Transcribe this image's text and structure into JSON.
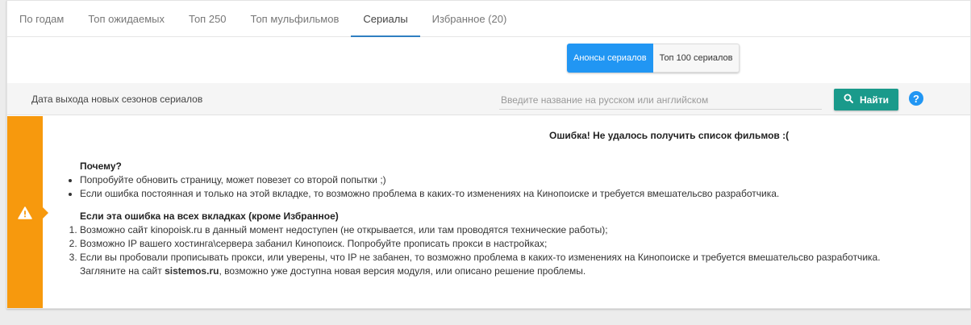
{
  "tabs": [
    {
      "label": "По годам"
    },
    {
      "label": "Топ ожидаемых"
    },
    {
      "label": "Топ 250"
    },
    {
      "label": "Топ мульфильмов"
    },
    {
      "label": "Сериалы"
    },
    {
      "label": "Избранное (20)"
    }
  ],
  "active_tab": "Сериалы",
  "series_toggle": {
    "announces": "Анонсы сериалов",
    "top100": "Топ 100 сериалов",
    "selected": "Анонсы сериалов"
  },
  "search": {
    "section_label": "Дата выхода новых сезонов сериалов",
    "placeholder": "Введите название на русском или английском",
    "value": "",
    "button_label": "Найти"
  },
  "alert": {
    "title": "Ошибка! Не удалось получить список фильмов :(",
    "why_heading": "Почему?",
    "why_items": [
      "Попробуйте обновить страницу, может повезет со второй попытки ;)",
      "Если ошибка постоянная и только на этой вкладке, то возможно проблема в каких-то изменениях на Кинопоиске и требуется вмешательсво разработчика."
    ],
    "all_tabs_heading": "Если эта ошибка на всех вкладках (кроме Избранное)",
    "all_tabs_items": [
      "Возможно сайт kinopoisk.ru в данный момент недоступен (не открывается, или там проводятся технические работы);",
      "Возможно IP вашего хостинга\\сервера забанил Кинопоиск. Попробуйте прописать прокси в настройках;",
      "Если вы пробовали прописывать прокси, или уверены, что IP не забанен, то возможно проблема в каких-то изменениях на Кинопоиске и требуется вмешательсво разработчика."
    ],
    "footer_before": "Загляните на сайт ",
    "footer_link": "sistemos.ru",
    "footer_after": ", возможно уже доступна новая версия модуля, или описано решение проблемы."
  },
  "colors": {
    "tab_active_underline": "#2f7fc1",
    "toggle_active": "#2196f3",
    "find_button": "#1a9a8b",
    "alert_stripe": "#f7990d",
    "help_icon": "#2196f3"
  },
  "icons": {
    "find": "search-icon",
    "help": "question-icon",
    "alert": "warning-icon"
  }
}
